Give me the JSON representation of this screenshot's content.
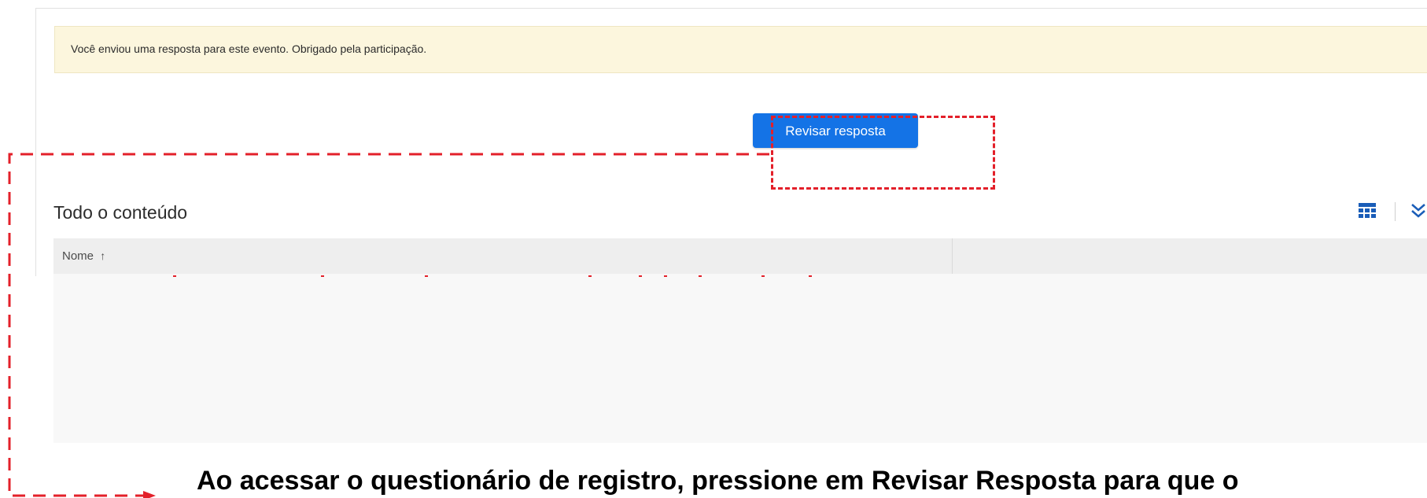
{
  "banner": {
    "message": "Você enviou uma resposta para este evento. Obrigado pela participação."
  },
  "actions": {
    "review_label": "Revisar resposta"
  },
  "content": {
    "title": "Todo o conteúdo",
    "icons": [
      "grid-view-icon",
      "chevron-double-down-icon"
    ],
    "table": {
      "columns": [
        {
          "label": "Nome",
          "sort": "ascending",
          "sort_glyph": "↑"
        },
        {
          "label": ""
        }
      ],
      "rows": []
    }
  },
  "annotation": {
    "caption": "Ao acessar o questionário de registro, pressione em Revisar Resposta para que o",
    "color": "#e3202a"
  },
  "colors": {
    "accent": "#1473e6",
    "banner_bg": "#fcf6dd",
    "grid_icon": "#1a5db8"
  }
}
